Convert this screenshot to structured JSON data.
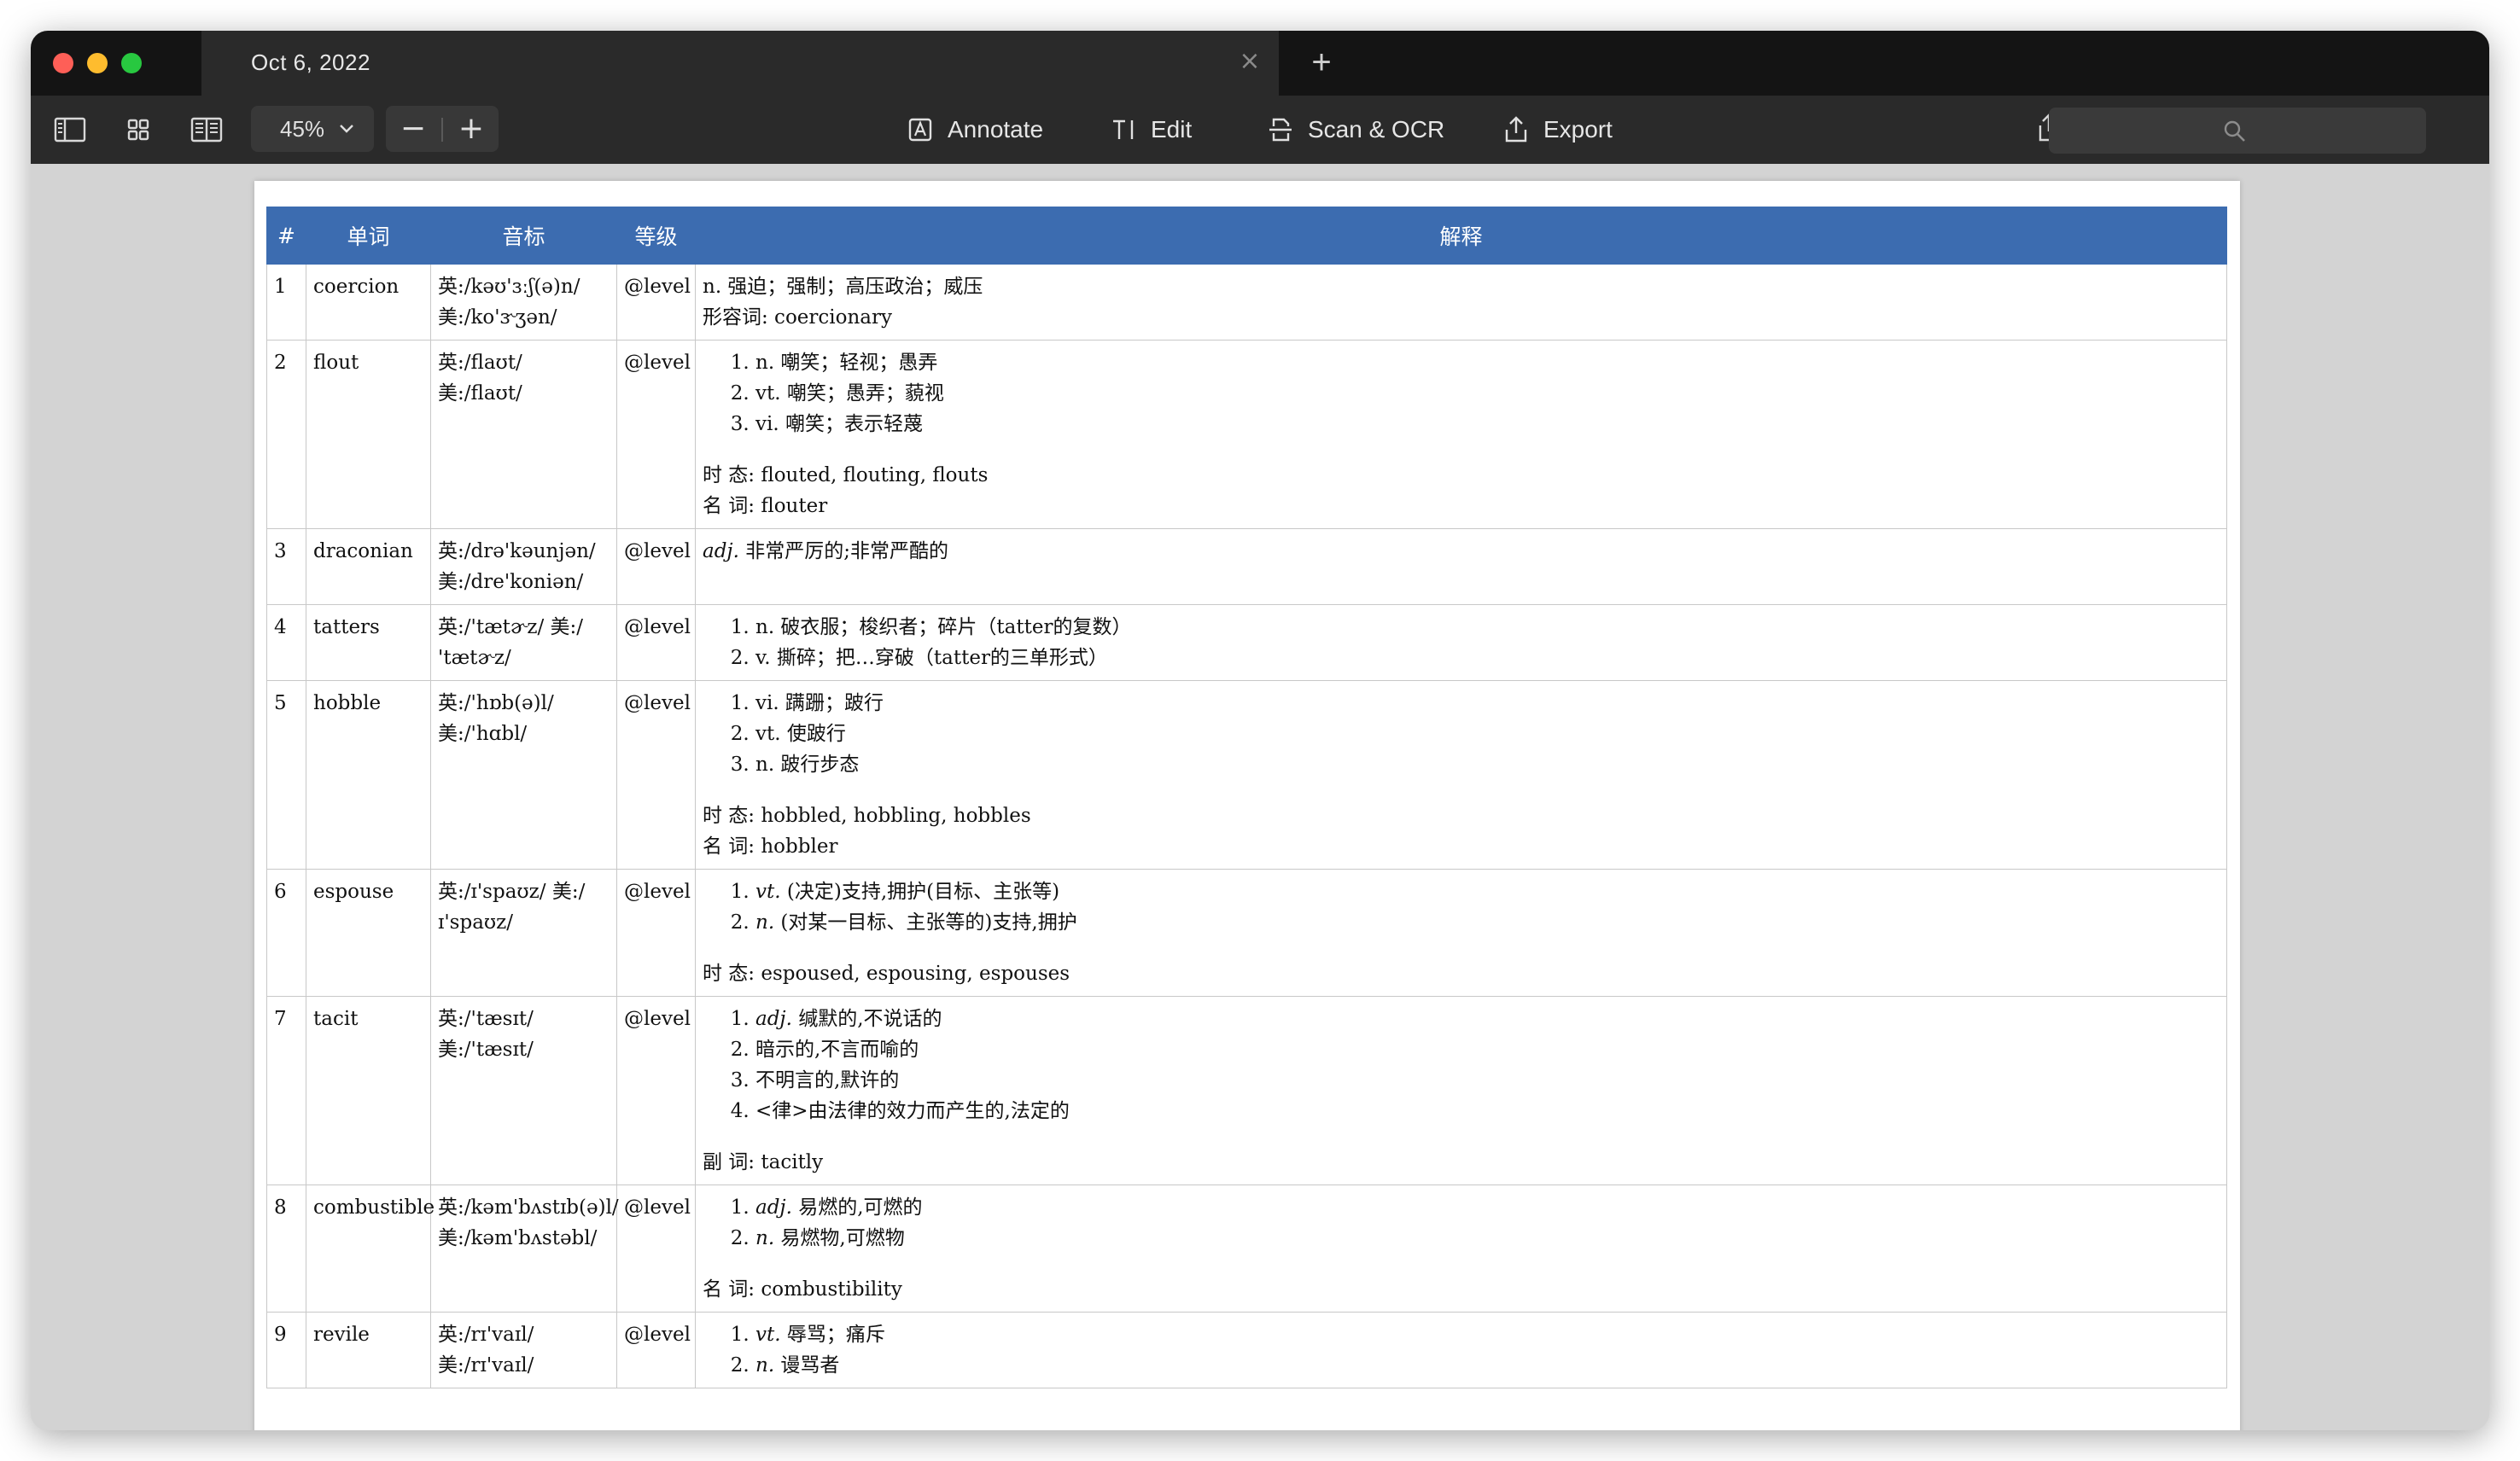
{
  "window": {
    "tab_title": "Oct 6, 2022",
    "close_tab_icon": "×",
    "new_tab_icon": "+"
  },
  "toolbar": {
    "zoom_value": "45%",
    "zoom_out_label": "−",
    "zoom_in_label": "+",
    "annotate_label": "Annotate",
    "edit_label": "Edit",
    "scan_label": "Scan & OCR",
    "export_label": "Export",
    "search_placeholder": ""
  },
  "table": {
    "headers": [
      "#",
      "单词",
      "音标",
      "等级",
      "解释"
    ],
    "rows": [
      {
        "num": "1",
        "word": "coercion",
        "phonetic": [
          "英:/kəʊ'ɜːʃ(ə)n/",
          "美:/ko'ɝʒən/"
        ],
        "level": "@level",
        "plain": [
          "n. 强迫；强制；高压政治；威压",
          "形容词: coercionary"
        ],
        "list": [],
        "extra": []
      },
      {
        "num": "2",
        "word": "flout",
        "phonetic": [
          "英:/flaʊt/",
          "美:/flaʊt/"
        ],
        "level": "@level",
        "plain": [],
        "list": [
          "n. 嘲笑；轻视；愚弄",
          "vt. 嘲笑；愚弄；藐视",
          "vi. 嘲笑；表示轻蔑"
        ],
        "extra": [
          "时 态: flouted, flouting, flouts",
          "名 词: flouter"
        ]
      },
      {
        "num": "3",
        "word": "draconian",
        "phonetic": [
          "英:/drə'kəunjən/",
          "美:/dre'koniən/"
        ],
        "level": "@level",
        "plain": [
          "adj. 非常严厉的;非常严酷的"
        ],
        "list": [],
        "extra": []
      },
      {
        "num": "4",
        "word": "tatters",
        "phonetic": [
          "英:/'tætɚz/ 美:/",
          "'tætɚz/"
        ],
        "level": "@level",
        "plain": [],
        "list": [
          "n. 破衣服；梭织者；碎片（tatter的复数）",
          "v. 撕碎；把…穿破（tatter的三单形式）"
        ],
        "extra": []
      },
      {
        "num": "5",
        "word": "hobble",
        "phonetic": [
          "英:/'hɒb(ə)l/",
          "美:/'hɑbl/"
        ],
        "level": "@level",
        "plain": [],
        "list": [
          "vi. 蹒跚；跛行",
          "vt. 使跛行",
          "n. 跛行步态"
        ],
        "extra": [
          "时 态: hobbled, hobbling, hobbles",
          "名 词: hobbler"
        ]
      },
      {
        "num": "6",
        "word": "espouse",
        "phonetic": [
          "英:/ɪ'spaʊz/ 美:/",
          "ɪ'spaʊz/"
        ],
        "level": "@level",
        "plain": [],
        "list": [
          "vt. (决定)支持,拥护(目标、主张等)",
          "n. (对某一目标、主张等的)支持,拥护"
        ],
        "extra": [
          "时 态: espoused, espousing, espouses"
        ]
      },
      {
        "num": "7",
        "word": "tacit",
        "phonetic": [
          "英:/'tæsɪt/",
          "美:/'tæsɪt/"
        ],
        "level": "@level",
        "plain": [],
        "list": [
          "adj. 缄默的,不说话的",
          "暗示的,不言而喻的",
          "不明言的,默许的",
          "<律>由法律的效力而产生的,法定的"
        ],
        "extra": [
          "副 词: tacitly"
        ]
      },
      {
        "num": "8",
        "word": "combustible",
        "phonetic": [
          "英:/kəm'bʌstɪb(ə)l/",
          "美:/kəm'bʌstəbl/"
        ],
        "level": "@level",
        "plain": [],
        "list": [
          "adj. 易燃的,可燃的",
          "n. 易燃物,可燃物"
        ],
        "extra": [
          "名 词: combustibility"
        ]
      },
      {
        "num": "9",
        "word": "revile",
        "phonetic": [
          "英:/rɪ'vaɪl/",
          "美:/rɪ'vaɪl/"
        ],
        "level": "@level",
        "plain": [],
        "list": [
          "vt. 辱骂；痛斥",
          "n. 谩骂者"
        ],
        "extra": []
      }
    ]
  }
}
